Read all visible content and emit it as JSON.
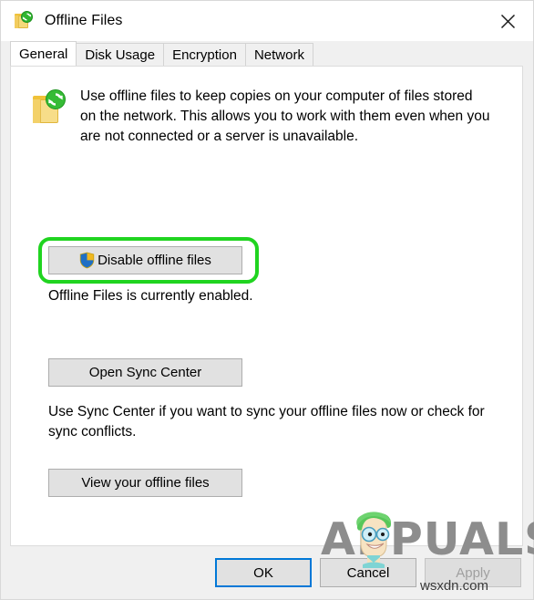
{
  "window": {
    "title": "Offline Files",
    "title_icon": "offline-files-folder-sync-icon",
    "close_icon": "close-icon"
  },
  "tabs": [
    {
      "label": "General",
      "active": true
    },
    {
      "label": "Disk Usage",
      "active": false
    },
    {
      "label": "Encryption",
      "active": false
    },
    {
      "label": "Network",
      "active": false
    }
  ],
  "general": {
    "banner_icon": "offline-files-folder-sync-icon",
    "description": "Use offline files to keep copies on your computer of files stored on the network.  This allows you to work with them even when you are not connected or a server is unavailable.",
    "disable_button": {
      "label": "Disable offline files",
      "icon": "uac-shield-icon",
      "highlighted": true,
      "highlight_color": "#20d420"
    },
    "status_text": "Offline Files is currently enabled.",
    "sync_center_button": "Open Sync Center",
    "sync_center_help": "Use Sync Center if you want to sync your offline files now or check for sync conflicts.",
    "view_files_button": "View your offline files"
  },
  "footer": {
    "ok_label": "OK",
    "cancel_label": "Cancel",
    "apply_label": "Apply",
    "apply_disabled": true,
    "ok_is_default": true,
    "default_focus_color": "#0078d7"
  },
  "overlays": {
    "watermark_text": "APPUALS",
    "watermark_mascot": "appuals-mascot-icon",
    "source_text": "wsxdn.com"
  }
}
